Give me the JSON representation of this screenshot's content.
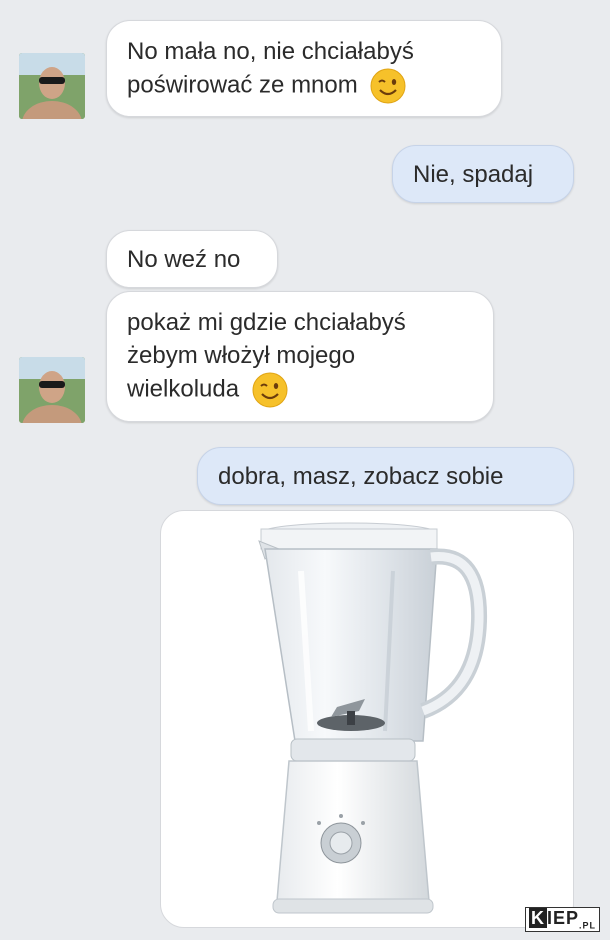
{
  "messages": [
    {
      "line1": "No mała no, nie chciałabyś",
      "line2": "poświrować ze mnom",
      "emoji": "wink-emoji"
    },
    {
      "text": "Nie, spadaj"
    },
    {
      "text": "No weź no"
    },
    {
      "line1": "pokaż mi gdzie chciałabyś",
      "line2": "żebym włożył mojego",
      "line3": "wielkoluda",
      "emoji": "wink-emoji"
    },
    {
      "text": "dobra, masz, zobacz sobie"
    }
  ],
  "attachment": {
    "icon": "blender-image"
  },
  "watermark": {
    "brand_k": "K",
    "brand_rest": "IEP",
    "brand_suffix": ".PL"
  },
  "colors": {
    "incoming_bubble": "#ffffff",
    "outgoing_bubble": "#dde8f8",
    "background": "#e9ebee"
  }
}
